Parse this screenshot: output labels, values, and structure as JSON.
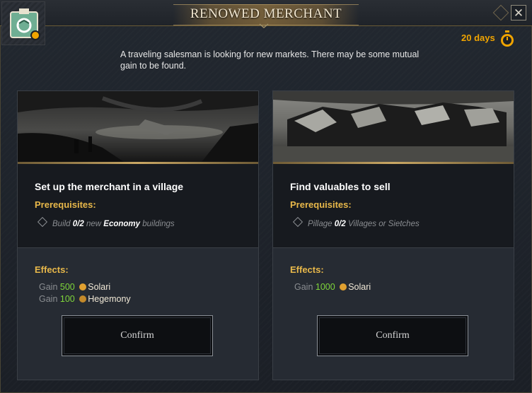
{
  "dialog": {
    "title": "RENOWED MERCHANT",
    "close_label": "✕",
    "badge_icon": "event-merchant-icon",
    "timer": "20 days",
    "timer_icon": "stopwatch-icon",
    "description": "A traveling salesman is looking for new markets. There may be some mutual gain to be found.",
    "colors": {
      "accent_gold": "#e8b84a",
      "timer_orange": "#f0a400",
      "value_green": "#7fd63a"
    }
  },
  "options": [
    {
      "title": "Set up the merchant in a village",
      "prereq_label": "Prerequisites:",
      "prereq": {
        "pre": "Build",
        "count": "0/2",
        "mid": "new",
        "highlight": "Economy",
        "post": "buildings"
      },
      "effects_label": "Effects:",
      "effects": [
        {
          "verb": "Gain",
          "amount": "500",
          "icon": "solari-icon",
          "resource": "Solari"
        },
        {
          "verb": "Gain",
          "amount": "100",
          "icon": "hegemony-icon",
          "resource": "Hegemony"
        }
      ],
      "confirm_label": "Confirm"
    },
    {
      "title": "Find valuables to sell",
      "prereq_label": "Prerequisites:",
      "prereq": {
        "pre": "Pillage",
        "count": "0/2",
        "post": "Villages or Sietches"
      },
      "effects_label": "Effects:",
      "effects": [
        {
          "verb": "Gain",
          "amount": "1000",
          "icon": "solari-icon",
          "resource": "Solari"
        }
      ],
      "confirm_label": "Confirm"
    }
  ]
}
